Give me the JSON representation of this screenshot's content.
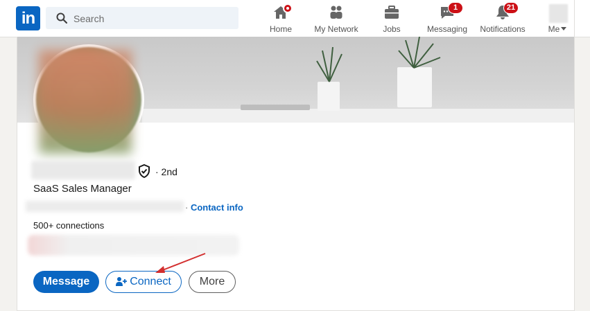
{
  "nav": {
    "logo": "in",
    "search_placeholder": "Search",
    "items": [
      {
        "label": "Home",
        "icon": "home-icon"
      },
      {
        "label": "My Network",
        "icon": "network-icon"
      },
      {
        "label": "Jobs",
        "icon": "jobs-icon"
      },
      {
        "label": "Messaging",
        "icon": "messaging-icon",
        "badge": "1"
      },
      {
        "label": "Notifications",
        "icon": "notifications-icon",
        "badge": "21"
      },
      {
        "label": "Me",
        "icon": "me-avatar"
      }
    ]
  },
  "profile": {
    "degree": "· 2nd",
    "headline": "SaaS Sales Manager",
    "contact_info": "Contact info",
    "connections": "500+ connections",
    "actions": {
      "message": "Message",
      "connect": "Connect",
      "more": "More"
    }
  },
  "colors": {
    "brand": "#0a66c2",
    "badge": "#cc1016",
    "annotation_arrow": "#d32f2f"
  }
}
